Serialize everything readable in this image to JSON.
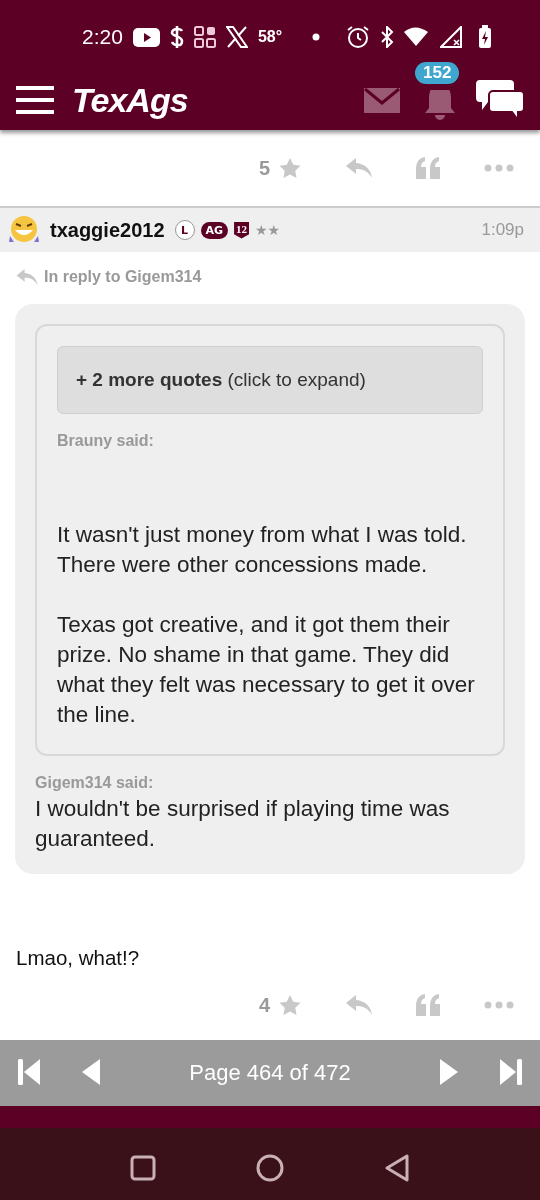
{
  "status_bar": {
    "time": "2:20",
    "temperature": "58°"
  },
  "header": {
    "logo": "TexAgs",
    "notification_count": "152"
  },
  "previous_post": {
    "star_count": "5"
  },
  "post": {
    "username": "txaggie2012",
    "badges": [
      {
        "kind": "circle",
        "label": "L"
      },
      {
        "kind": "pill",
        "label": "AG"
      },
      {
        "kind": "shield",
        "label": "12"
      }
    ],
    "rank": "★★",
    "time": "1:09p",
    "reply_to": "In reply to Gigem314",
    "quote": {
      "expand": "**+ 2 more quotes** (click to expand)",
      "inner_author": "Brauny said:",
      "inner_paragraphs": [
        "It wasn't just money from what I was told. There were other concessions made.",
        "Texas got creative, and it got them their prize. No shame in that game. They did what they felt was necessary to get it over the line."
      ],
      "author": "Gigem314 said:",
      "text": "I wouldn't be surprised if playing time was guaranteed."
    },
    "body": "Lmao, what!?",
    "star_count": "4"
  },
  "pager": {
    "label": "Page 464 of 472"
  }
}
